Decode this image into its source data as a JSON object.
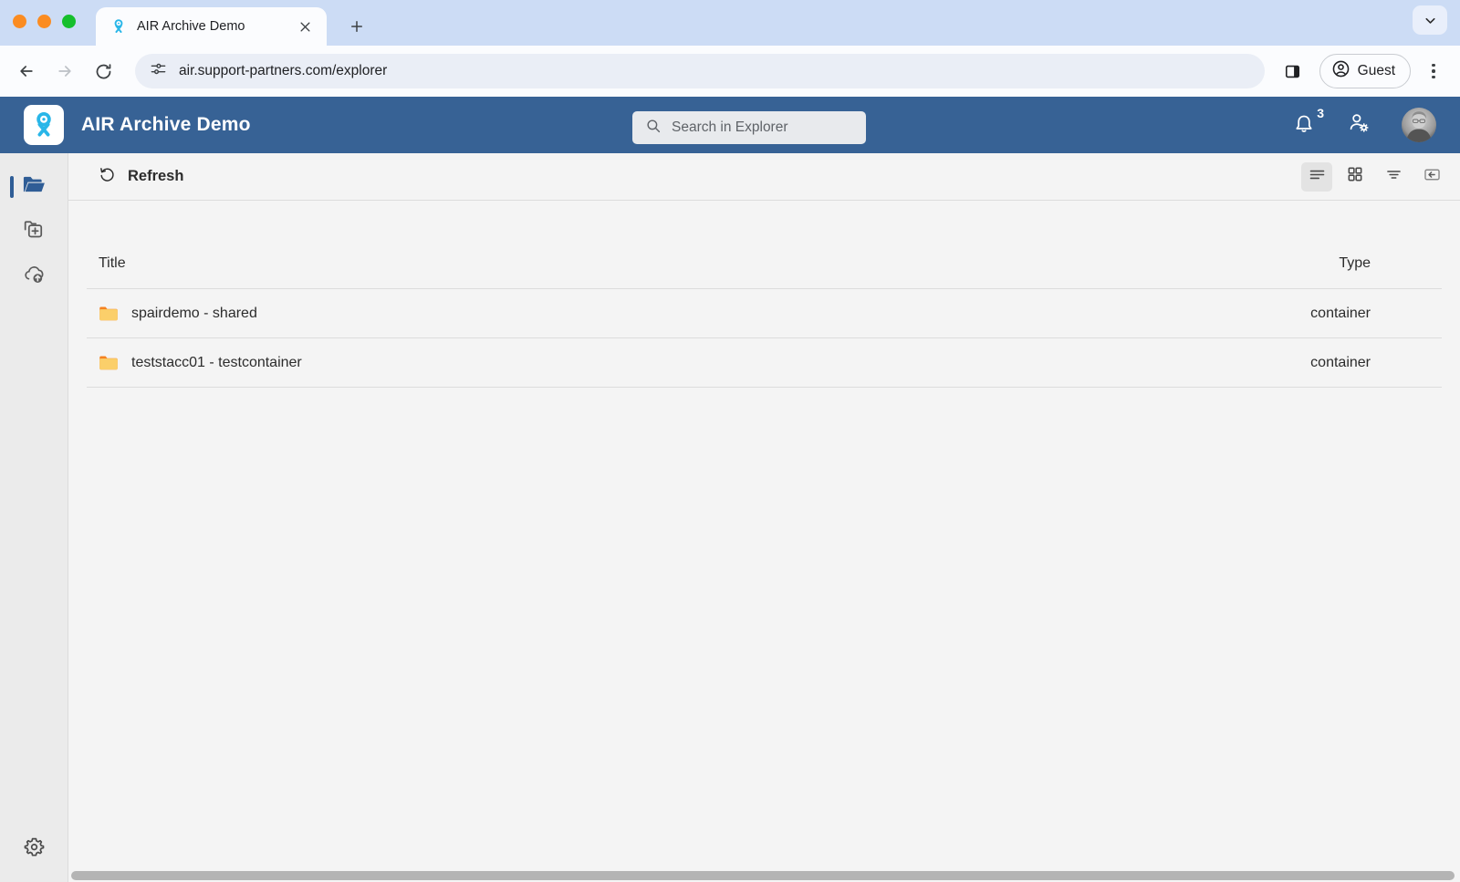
{
  "browser": {
    "window_controls": [
      "close",
      "minimize",
      "maximize"
    ],
    "tab": {
      "title": "AIR Archive Demo",
      "favicon_name": "air-ribbon-favicon",
      "close_label": "×"
    },
    "new_tab_label": "+",
    "tab_list_icon": "chevron-down-icon",
    "nav": {
      "back_icon": "arrow-left-icon",
      "forward_icon": "arrow-right-icon",
      "reload_icon": "reload-icon"
    },
    "omnibox": {
      "site_info_icon": "tune-icon",
      "url": "air.support-partners.com/explorer"
    },
    "side_panel_icon": "side-panel-icon",
    "profile": {
      "label": "Guest",
      "icon": "account-circle-icon"
    },
    "menu_icon": "three-dot-menu-icon"
  },
  "app": {
    "header": {
      "logo_name": "air-logo",
      "title": "AIR Archive Demo",
      "background_color": "#376295",
      "search": {
        "icon": "search-icon",
        "placeholder": "Search in Explorer",
        "value": ""
      },
      "notifications": {
        "icon": "bell-icon",
        "count": "3"
      },
      "user_settings_icon": "user-settings-icon",
      "avatar_name": "user-avatar"
    },
    "sidebar": {
      "items": [
        {
          "name": "explorer",
          "icon": "folder-open-icon",
          "active": true
        },
        {
          "name": "new-archive",
          "icon": "add-folder-icon",
          "active": false
        },
        {
          "name": "upload",
          "icon": "cloud-upload-icon",
          "active": false
        }
      ],
      "bottom": {
        "name": "settings",
        "icon": "gear-icon"
      }
    },
    "toolbar": {
      "refresh": {
        "icon": "refresh-icon",
        "label": "Refresh"
      },
      "view_buttons": [
        {
          "name": "list-view",
          "icon": "list-view-icon",
          "active": true
        },
        {
          "name": "grid-view",
          "icon": "grid-view-icon",
          "active": false
        },
        {
          "name": "filter",
          "icon": "filter-icon",
          "active": false
        },
        {
          "name": "collapse-panel",
          "icon": "collapse-panel-icon",
          "active": false
        }
      ]
    },
    "table": {
      "columns": [
        {
          "key": "title",
          "label": "Title"
        },
        {
          "key": "type",
          "label": "Type"
        }
      ],
      "rows": [
        {
          "icon": "folder-icon",
          "title": "spairdemo - shared",
          "type": "container"
        },
        {
          "icon": "folder-icon",
          "title": "teststacc01 - testcontainer",
          "type": "container"
        }
      ]
    },
    "scrollbar": {
      "orientation": "horizontal"
    }
  },
  "colors": {
    "header_blue": "#376295",
    "logo_cyan": "#29b6e8",
    "folder_yellow": "#fbcf6a",
    "folder_tab_orange": "#f58220",
    "accent_active": "#2f5d96"
  }
}
